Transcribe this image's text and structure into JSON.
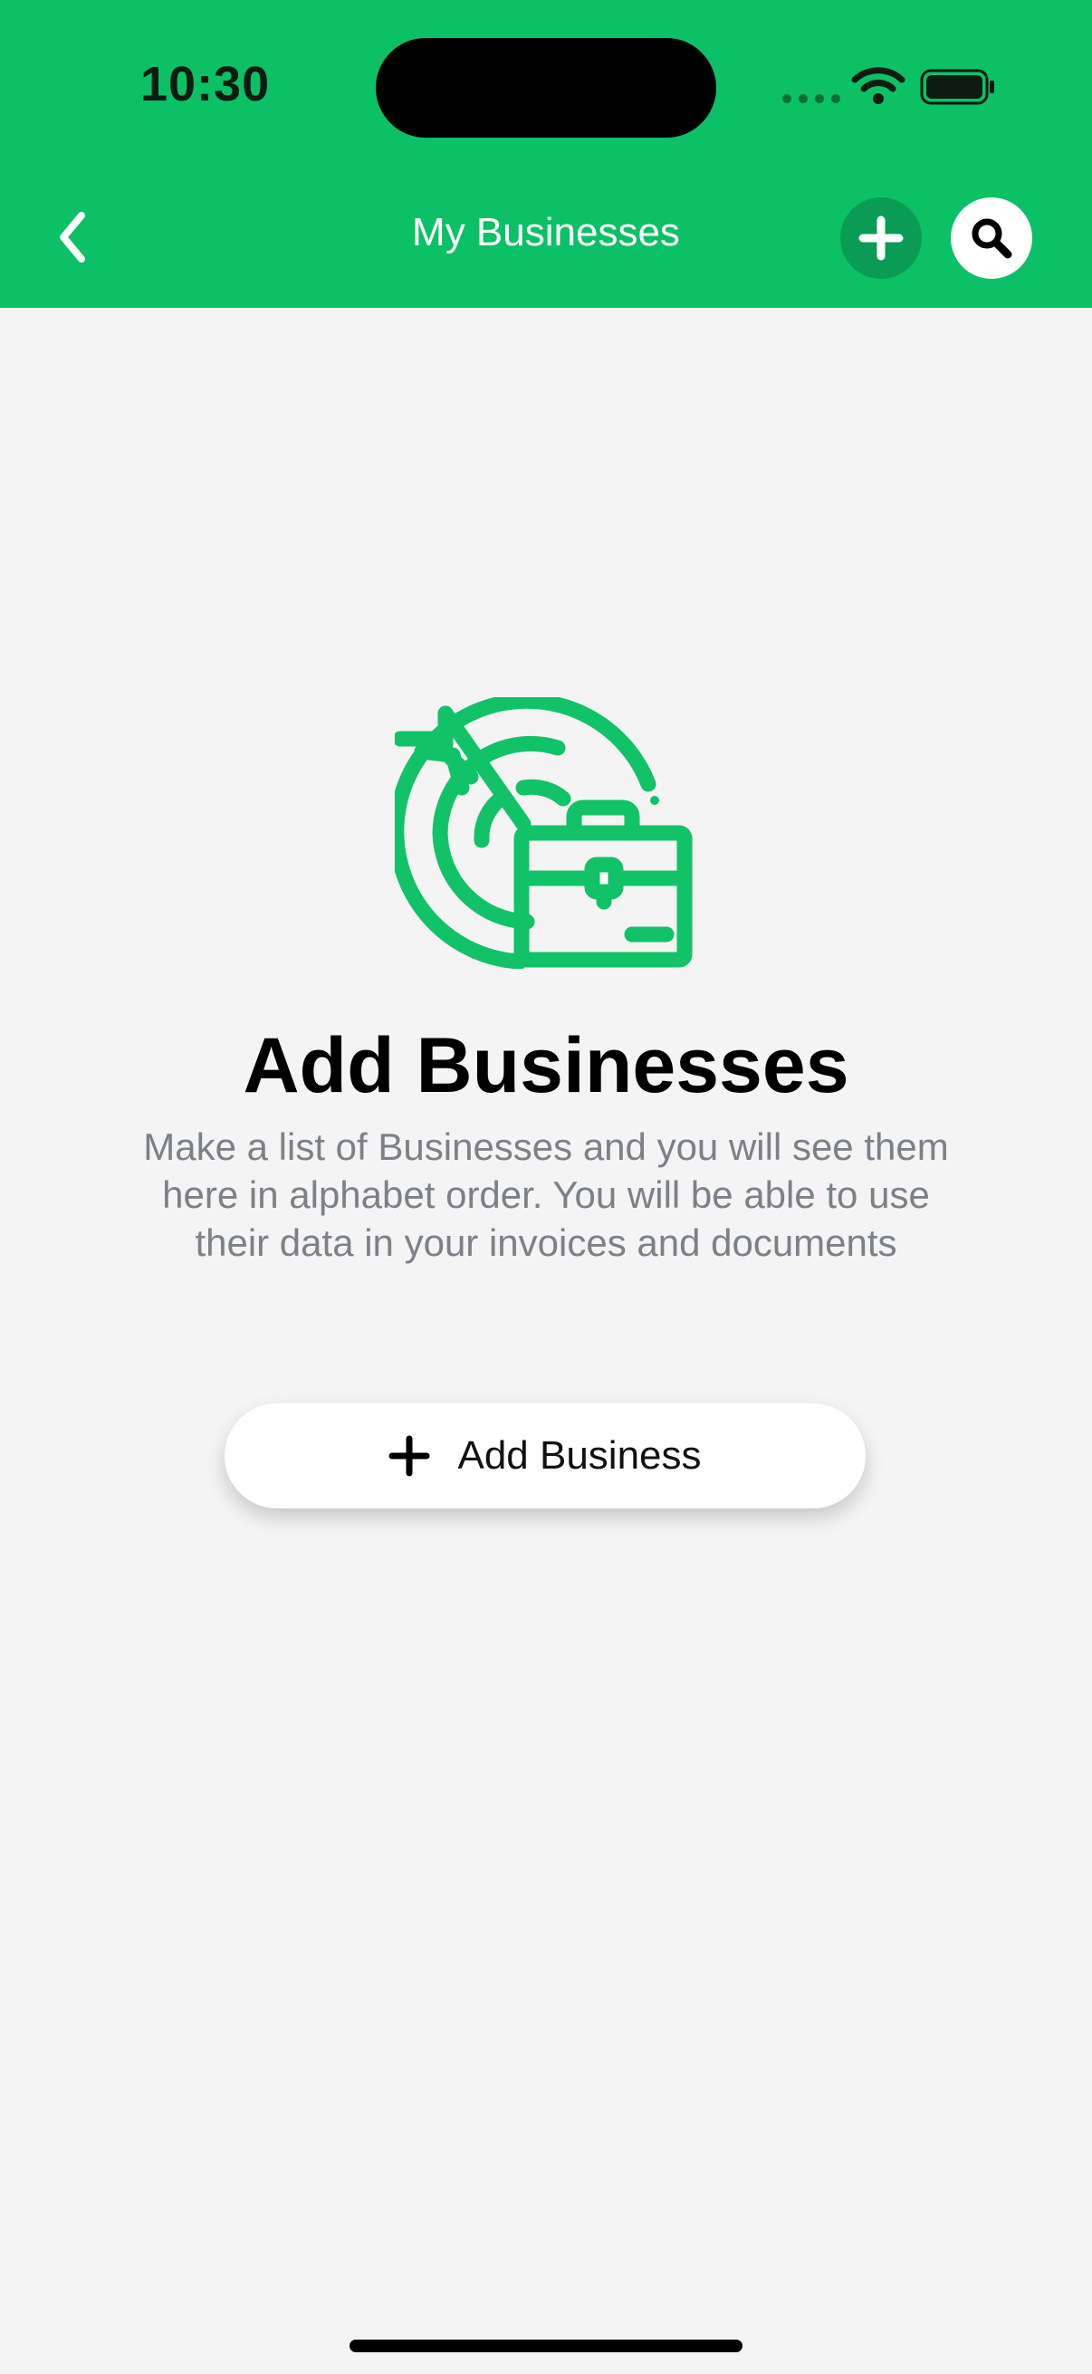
{
  "status_bar": {
    "time": "10:30"
  },
  "nav": {
    "title": "My Businesses",
    "back_icon": "chevron-left-icon",
    "add_icon": "plus-icon",
    "search_icon": "search-icon"
  },
  "empty_state": {
    "illustration_icon": "target-briefcase-icon",
    "title": "Add Businesses",
    "description": "Make a list of Businesses and you will see them here in alphabet order. You will be able to use their data in your invoices and documents",
    "button_label": "Add Business",
    "button_icon": "plus-icon"
  },
  "colors": {
    "header_green": "#0bc065",
    "accent_green": "#12c267",
    "add_circle_green": "#0a9c55",
    "background": "#f4f4f4",
    "description_gray": "#7c8087"
  }
}
